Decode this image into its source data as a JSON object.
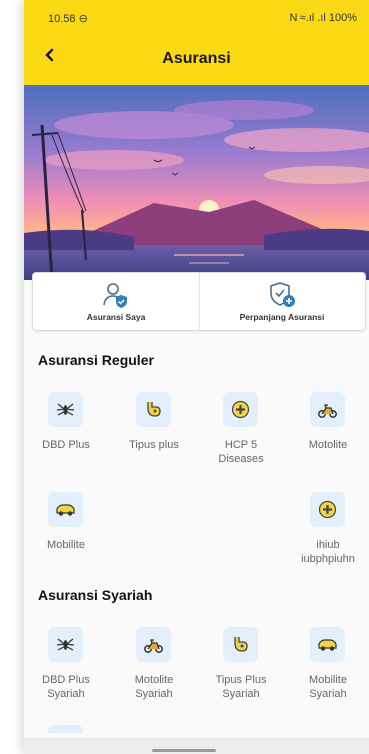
{
  "status_bar": {
    "time": "10.58",
    "time_icon": "clock-icon",
    "right": "N ≈.ıl .ıl 100%"
  },
  "header": {
    "title": "Asuransi",
    "back_icon": "chevron-left-icon"
  },
  "quick_actions": [
    {
      "label": "Asuransi Saya",
      "icon": "user-shield-icon"
    },
    {
      "label": "Perpanjang Asuransi",
      "icon": "shield-plus-icon"
    }
  ],
  "sections": {
    "reguler": {
      "title": "Asuransi Reguler",
      "items": [
        {
          "label": "DBD Plus",
          "icon": "mosquito-icon"
        },
        {
          "label": "Tipus plus",
          "icon": "stomach-icon"
        },
        {
          "label": "HCP 5\nDiseases",
          "icon": "medical-cross-icon"
        },
        {
          "label": "Motolite",
          "icon": "motorcycle-icon"
        },
        {
          "label": "Mobilite",
          "icon": "car-icon"
        },
        {
          "label": "ihiub\niubphpiuhn",
          "icon": "medical-cross-icon"
        }
      ]
    },
    "syariah": {
      "title": "Asuransi Syariah",
      "items": [
        {
          "label": "DBD Plus\nSyariah",
          "icon": "mosquito-icon"
        },
        {
          "label": "Motolite\nSyariah",
          "icon": "motorcycle-icon"
        },
        {
          "label": "Tipus Plus\nSyariah",
          "icon": "stomach-icon"
        },
        {
          "label": "Mobilite\nSyariah",
          "icon": "car-icon"
        }
      ]
    }
  },
  "colors": {
    "accent": "#fbd914",
    "icon_bg": "#e3f0fb",
    "icon_fg": "#2f7fc1"
  }
}
